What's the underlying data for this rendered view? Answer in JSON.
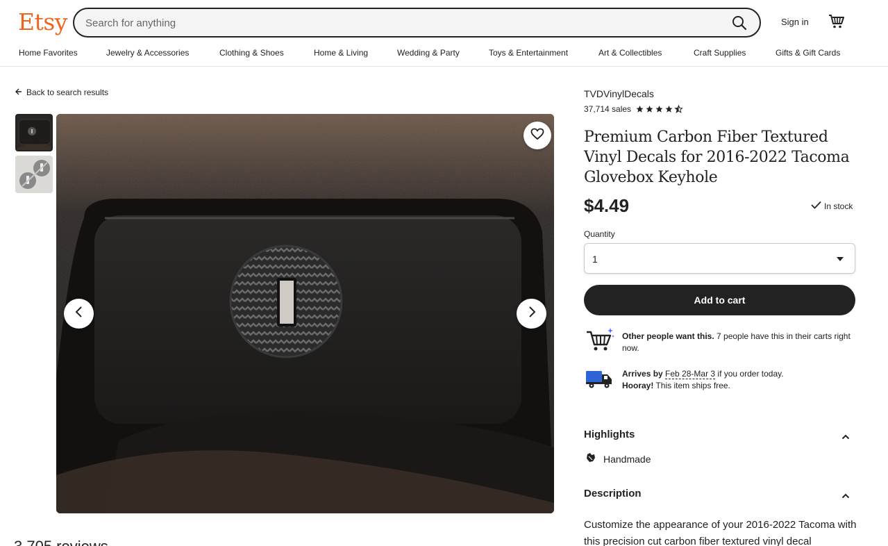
{
  "header": {
    "logo": "Etsy",
    "search_placeholder": "Search for anything",
    "signin": "Sign in"
  },
  "categories": [
    "Home Favorites",
    "Jewelry & Accessories",
    "Clothing & Shoes",
    "Home & Living",
    "Wedding & Party",
    "Toys & Entertainment",
    "Art & Collectibles",
    "Craft Supplies",
    "Gifts & Gift Cards"
  ],
  "back_link": "Back to search results",
  "product": {
    "shop": "TVDVinylDecals",
    "sales": "37,714 sales",
    "rating": 4.5,
    "title": "Premium Carbon Fiber Textured Vinyl Decals for 2016-2022 Tacoma Glovebox Keyhole",
    "price": "$4.49",
    "stock": "In stock",
    "quantity_label": "Quantity",
    "quantity_value": "1",
    "add_to_cart": "Add to cart"
  },
  "notices": {
    "demand_bold": "Other people want this.",
    "demand_text": " 7 people have this in their carts right now.",
    "arrives_bold": "Arrives by",
    "arrives_date": "Feb 28-Mar 3",
    "arrives_text": " if you order today.",
    "ships_bold": "Hooray!",
    "ships_text": " This item ships free."
  },
  "highlights": {
    "heading": "Highlights",
    "item": "Handmade"
  },
  "description": {
    "heading": "Description",
    "text": "Customize the appearance of your 2016-2022 Tacoma with this precision cut carbon fiber textured vinyl decal"
  },
  "reviews_peek": "3,705 reviews",
  "colors": {
    "brand": "#f1641e",
    "primary": "#222222"
  }
}
